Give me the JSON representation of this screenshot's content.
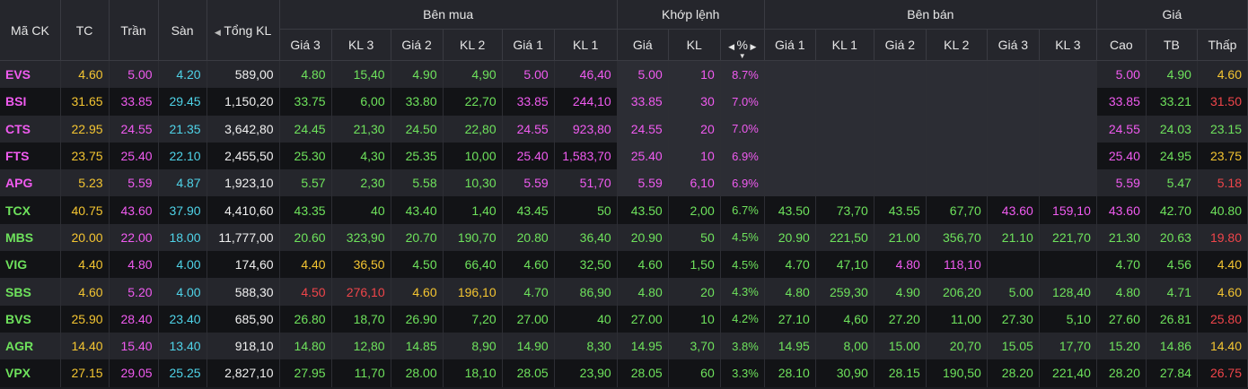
{
  "header": {
    "symbol": "Mã CK",
    "ref": "TC",
    "ceiling": "Trần",
    "floor": "Sàn",
    "total_vol": "Tổng KL",
    "buy_group": "Bên mua",
    "match_group": "Khớp lệnh",
    "sell_group": "Bên bán",
    "price_group": "Giá",
    "buy_cols": [
      "Giá 3",
      "KL 3",
      "Giá 2",
      "KL 2",
      "Giá 1",
      "KL 1"
    ],
    "match_cols": [
      "Giá",
      "KL",
      "%"
    ],
    "sell_cols": [
      "Giá 1",
      "KL 1",
      "Giá 2",
      "KL 2",
      "Giá 3",
      "KL 3"
    ],
    "price_cols": [
      "Cao",
      "TB",
      "Thấp"
    ]
  },
  "colors": {
    "ceiling": "#f05bf0",
    "up": "#6ee25c",
    "ref": "#f4c531",
    "down": "#f0454a",
    "floor": "#4fd3e8",
    "neutral": "#f0f0f0"
  },
  "rows": [
    {
      "sym": "EVS",
      "tc": "4.60",
      "tran": "5.00",
      "san": "4.20",
      "tkl": "589,00",
      "b": [
        "4.80",
        "15,40",
        "4.90",
        "4,90",
        "5.00",
        "46,40"
      ],
      "m": [
        "5.00",
        "10",
        "8.7%"
      ],
      "s": [
        "",
        "",
        "",
        "",
        "",
        ""
      ],
      "h": [
        "5.00",
        "4.90",
        "4.60"
      ],
      "sc": "p",
      "bc": [
        "g",
        "g",
        "g",
        "g",
        "p",
        "p"
      ],
      "mc": [
        "p",
        "p",
        "p"
      ],
      "scc": [
        "",
        "",
        "",
        "",
        "",
        ""
      ],
      "hc": [
        "p",
        "g",
        "y"
      ],
      "shadeMatch": true
    },
    {
      "sym": "BSI",
      "tc": "31.65",
      "tran": "33.85",
      "san": "29.45",
      "tkl": "1,150,20",
      "b": [
        "33.75",
        "6,00",
        "33.80",
        "22,70",
        "33.85",
        "244,10"
      ],
      "m": [
        "33.85",
        "30",
        "7.0%"
      ],
      "s": [
        "",
        "",
        "",
        "",
        "",
        ""
      ],
      "h": [
        "33.85",
        "33.21",
        "31.50"
      ],
      "sc": "p",
      "bc": [
        "g",
        "g",
        "g",
        "g",
        "p",
        "p"
      ],
      "mc": [
        "p",
        "p",
        "p"
      ],
      "scc": [
        "",
        "",
        "",
        "",
        "",
        ""
      ],
      "hc": [
        "p",
        "g",
        "r"
      ],
      "shadeMatch": true
    },
    {
      "sym": "CTS",
      "tc": "22.95",
      "tran": "24.55",
      "san": "21.35",
      "tkl": "3,642,80",
      "b": [
        "24.45",
        "21,30",
        "24.50",
        "22,80",
        "24.55",
        "923,80"
      ],
      "m": [
        "24.55",
        "20",
        "7.0%"
      ],
      "s": [
        "",
        "",
        "",
        "",
        "",
        ""
      ],
      "h": [
        "24.55",
        "24.03",
        "23.15"
      ],
      "sc": "p",
      "bc": [
        "g",
        "g",
        "g",
        "g",
        "p",
        "p"
      ],
      "mc": [
        "p",
        "p",
        "p"
      ],
      "scc": [
        "",
        "",
        "",
        "",
        "",
        ""
      ],
      "hc": [
        "p",
        "g",
        "g"
      ],
      "shadeMatch": true
    },
    {
      "sym": "FTS",
      "tc": "23.75",
      "tran": "25.40",
      "san": "22.10",
      "tkl": "2,455,50",
      "b": [
        "25.30",
        "4,30",
        "25.35",
        "10,00",
        "25.40",
        "1,583,70"
      ],
      "m": [
        "25.40",
        "10",
        "6.9%"
      ],
      "s": [
        "",
        "",
        "",
        "",
        "",
        ""
      ],
      "h": [
        "25.40",
        "24.95",
        "23.75"
      ],
      "sc": "p",
      "bc": [
        "g",
        "g",
        "g",
        "g",
        "p",
        "p"
      ],
      "mc": [
        "p",
        "p",
        "p"
      ],
      "scc": [
        "",
        "",
        "",
        "",
        "",
        ""
      ],
      "hc": [
        "p",
        "g",
        "y"
      ],
      "shadeMatch": true
    },
    {
      "sym": "APG",
      "tc": "5.23",
      "tran": "5.59",
      "san": "4.87",
      "tkl": "1,923,10",
      "b": [
        "5.57",
        "2,30",
        "5.58",
        "10,30",
        "5.59",
        "51,70"
      ],
      "m": [
        "5.59",
        "6,10",
        "6.9%"
      ],
      "s": [
        "",
        "",
        "",
        "",
        "",
        ""
      ],
      "h": [
        "5.59",
        "5.47",
        "5.18"
      ],
      "sc": "p",
      "bc": [
        "g",
        "g",
        "g",
        "g",
        "p",
        "p"
      ],
      "mc": [
        "p",
        "p",
        "p"
      ],
      "scc": [
        "",
        "",
        "",
        "",
        "",
        ""
      ],
      "hc": [
        "p",
        "g",
        "r"
      ],
      "shadeMatch": true
    },
    {
      "sym": "TCX",
      "tc": "40.75",
      "tran": "43.60",
      "san": "37.90",
      "tkl": "4,410,60",
      "b": [
        "43.35",
        "40",
        "43.40",
        "1,40",
        "43.45",
        "50"
      ],
      "m": [
        "43.50",
        "2,00",
        "6.7%"
      ],
      "s": [
        "43.50",
        "73,70",
        "43.55",
        "67,70",
        "43.60",
        "159,10"
      ],
      "h": [
        "43.60",
        "42.70",
        "40.80"
      ],
      "sc": "g",
      "bc": [
        "g",
        "g",
        "g",
        "g",
        "g",
        "g"
      ],
      "mc": [
        "g",
        "g",
        "g"
      ],
      "scc": [
        "g",
        "g",
        "g",
        "g",
        "p",
        "p"
      ],
      "hc": [
        "p",
        "g",
        "g"
      ],
      "shadeMatch": false
    },
    {
      "sym": "MBS",
      "tc": "20.00",
      "tran": "22.00",
      "san": "18.00",
      "tkl": "11,777,00",
      "b": [
        "20.60",
        "323,90",
        "20.70",
        "190,70",
        "20.80",
        "36,40"
      ],
      "m": [
        "20.90",
        "50",
        "4.5%"
      ],
      "s": [
        "20.90",
        "221,50",
        "21.00",
        "356,70",
        "21.10",
        "221,70"
      ],
      "h": [
        "21.30",
        "20.63",
        "19.80"
      ],
      "sc": "g",
      "bc": [
        "g",
        "g",
        "g",
        "g",
        "g",
        "g"
      ],
      "mc": [
        "g",
        "g",
        "g"
      ],
      "scc": [
        "g",
        "g",
        "g",
        "g",
        "g",
        "g"
      ],
      "hc": [
        "g",
        "g",
        "r"
      ],
      "shadeMatch": false
    },
    {
      "sym": "VIG",
      "tc": "4.40",
      "tran": "4.80",
      "san": "4.00",
      "tkl": "174,60",
      "b": [
        "4.40",
        "36,50",
        "4.50",
        "66,40",
        "4.60",
        "32,50"
      ],
      "m": [
        "4.60",
        "1,50",
        "4.5%"
      ],
      "s": [
        "4.70",
        "47,10",
        "4.80",
        "118,10",
        "",
        ""
      ],
      "h": [
        "4.70",
        "4.56",
        "4.40"
      ],
      "sc": "g",
      "bc": [
        "y",
        "y",
        "g",
        "g",
        "g",
        "g"
      ],
      "mc": [
        "g",
        "g",
        "g"
      ],
      "scc": [
        "g",
        "g",
        "p",
        "p",
        "",
        ""
      ],
      "hc": [
        "g",
        "g",
        "y"
      ],
      "shadeMatch": false
    },
    {
      "sym": "SBS",
      "tc": "4.60",
      "tran": "5.20",
      "san": "4.00",
      "tkl": "588,30",
      "b": [
        "4.50",
        "276,10",
        "4.60",
        "196,10",
        "4.70",
        "86,90"
      ],
      "m": [
        "4.80",
        "20",
        "4.3%"
      ],
      "s": [
        "4.80",
        "259,30",
        "4.90",
        "206,20",
        "5.00",
        "128,40"
      ],
      "h": [
        "4.80",
        "4.71",
        "4.60"
      ],
      "sc": "g",
      "bc": [
        "r",
        "r",
        "y",
        "y",
        "g",
        "g"
      ],
      "mc": [
        "g",
        "g",
        "g"
      ],
      "scc": [
        "g",
        "g",
        "g",
        "g",
        "g",
        "g"
      ],
      "hc": [
        "g",
        "g",
        "y"
      ],
      "shadeMatch": false
    },
    {
      "sym": "BVS",
      "tc": "25.90",
      "tran": "28.40",
      "san": "23.40",
      "tkl": "685,90",
      "b": [
        "26.80",
        "18,70",
        "26.90",
        "7,20",
        "27.00",
        "40"
      ],
      "m": [
        "27.00",
        "10",
        "4.2%"
      ],
      "s": [
        "27.10",
        "4,60",
        "27.20",
        "11,00",
        "27.30",
        "5,10"
      ],
      "h": [
        "27.60",
        "26.81",
        "25.80"
      ],
      "sc": "g",
      "bc": [
        "g",
        "g",
        "g",
        "g",
        "g",
        "g"
      ],
      "mc": [
        "g",
        "g",
        "g"
      ],
      "scc": [
        "g",
        "g",
        "g",
        "g",
        "g",
        "g"
      ],
      "hc": [
        "g",
        "g",
        "r"
      ],
      "shadeMatch": false
    },
    {
      "sym": "AGR",
      "tc": "14.40",
      "tran": "15.40",
      "san": "13.40",
      "tkl": "918,10",
      "b": [
        "14.80",
        "12,80",
        "14.85",
        "8,90",
        "14.90",
        "8,30"
      ],
      "m": [
        "14.95",
        "3,70",
        "3.8%"
      ],
      "s": [
        "14.95",
        "8,00",
        "15.00",
        "20,70",
        "15.05",
        "17,70"
      ],
      "h": [
        "15.20",
        "14.86",
        "14.40"
      ],
      "sc": "g",
      "bc": [
        "g",
        "g",
        "g",
        "g",
        "g",
        "g"
      ],
      "mc": [
        "g",
        "g",
        "g"
      ],
      "scc": [
        "g",
        "g",
        "g",
        "g",
        "g",
        "g"
      ],
      "hc": [
        "g",
        "g",
        "y"
      ],
      "shadeMatch": false
    },
    {
      "sym": "VPX",
      "tc": "27.15",
      "tran": "29.05",
      "san": "25.25",
      "tkl": "2,827,10",
      "b": [
        "27.95",
        "11,70",
        "28.00",
        "18,10",
        "28.05",
        "23,90"
      ],
      "m": [
        "28.05",
        "60",
        "3.3%"
      ],
      "s": [
        "28.10",
        "30,90",
        "28.15",
        "190,50",
        "28.20",
        "221,40"
      ],
      "h": [
        "28.20",
        "27.84",
        "26.75"
      ],
      "sc": "g",
      "bc": [
        "g",
        "g",
        "g",
        "g",
        "g",
        "g"
      ],
      "mc": [
        "g",
        "g",
        "g"
      ],
      "scc": [
        "g",
        "g",
        "g",
        "g",
        "g",
        "g"
      ],
      "hc": [
        "g",
        "g",
        "r"
      ],
      "shadeMatch": false
    }
  ]
}
